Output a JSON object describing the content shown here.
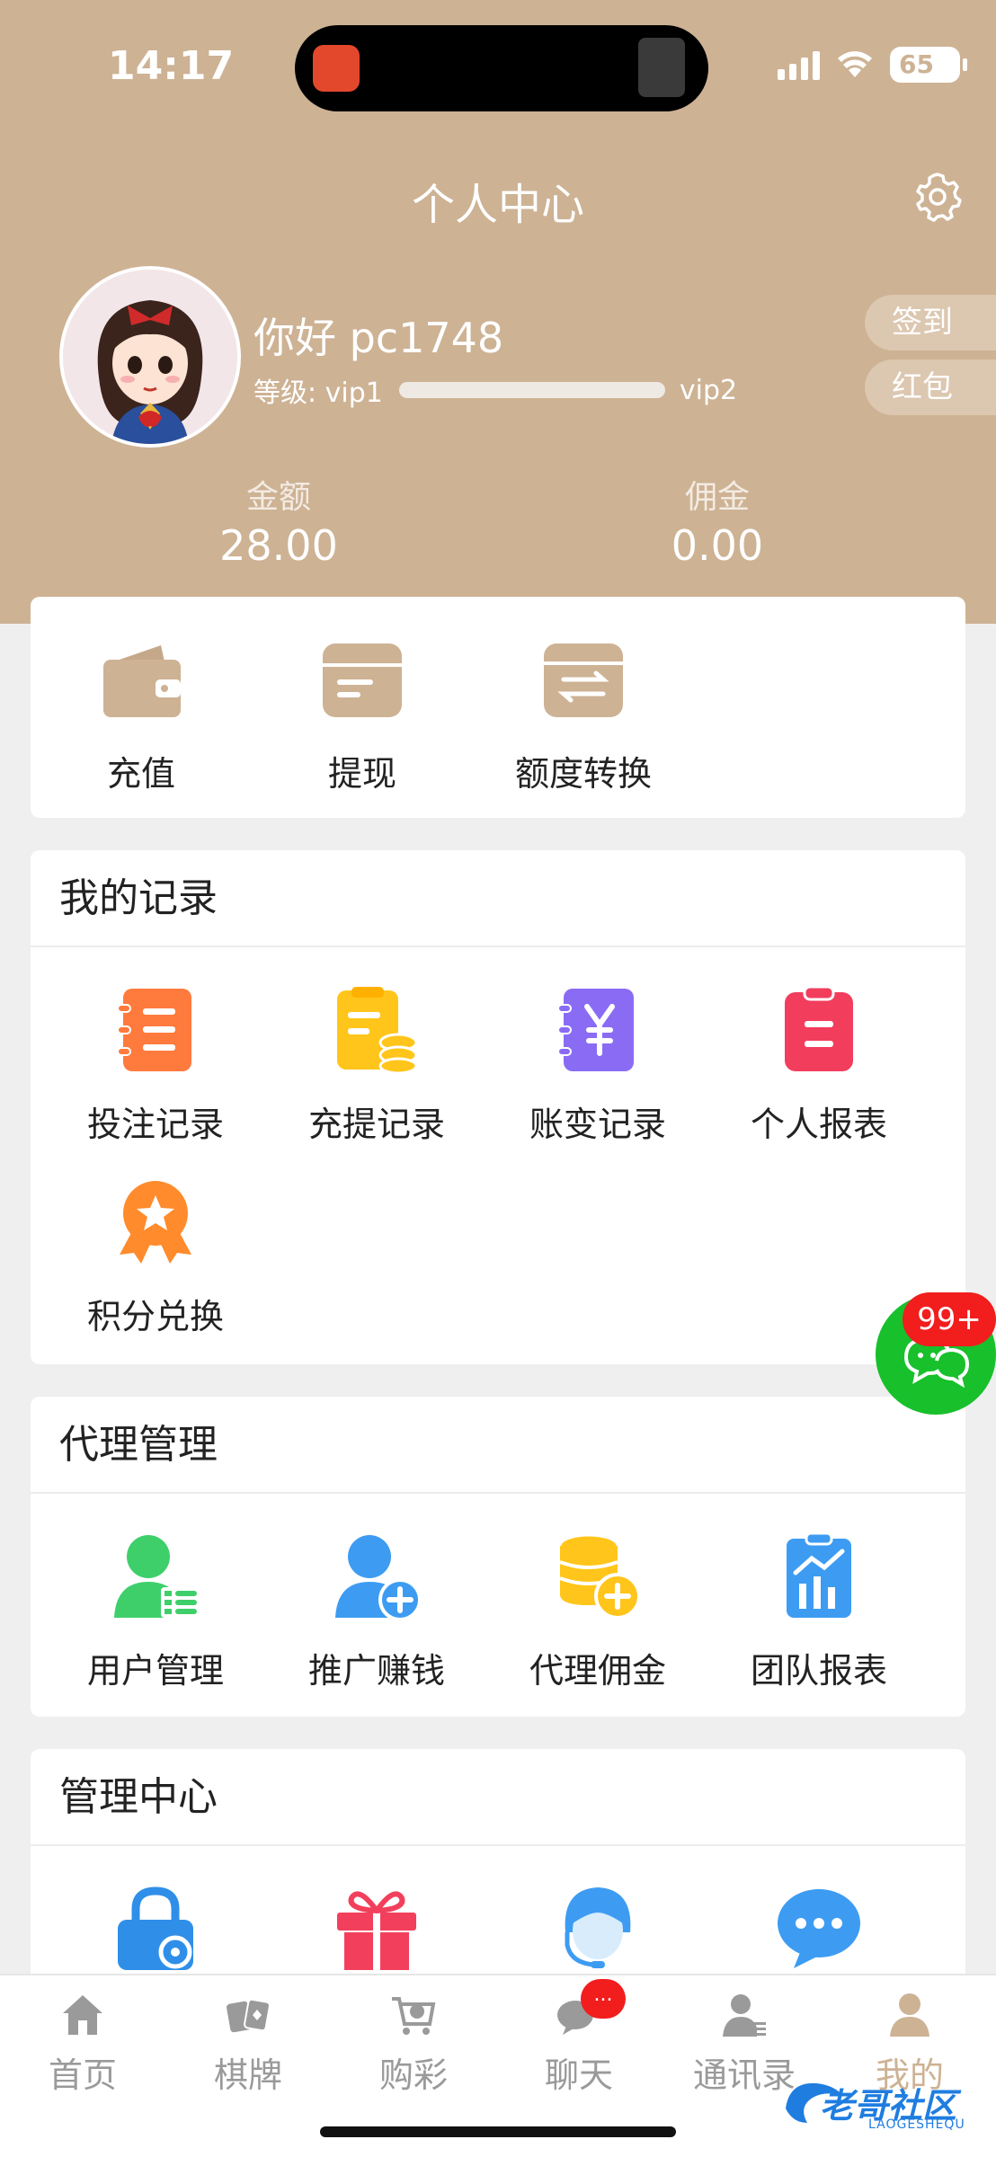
{
  "status": {
    "time": "14:17",
    "battery": "65"
  },
  "header": {
    "title": "个人中心"
  },
  "profile": {
    "greeting": "你好 pc1748",
    "level_label": "等级: vip1",
    "level_next": "vip2",
    "level_progress": 0.0,
    "sign_in": "签到",
    "red_packet": "红包",
    "balance_label": "金额",
    "balance_value": "28.00",
    "commission_label": "佣金",
    "commission_value": "0.00"
  },
  "wallet": {
    "items": [
      {
        "label": "充值",
        "icon": "wallet-icon"
      },
      {
        "label": "提现",
        "icon": "card-icon"
      },
      {
        "label": "额度转换",
        "icon": "transfer-icon"
      }
    ]
  },
  "records": {
    "title": "我的记录",
    "items": [
      {
        "label": "投注记录",
        "icon": "bet-record-icon",
        "color": "#ff7a3d"
      },
      {
        "label": "充提记录",
        "icon": "deposit-record-icon",
        "color": "#ffc51a"
      },
      {
        "label": "账变记录",
        "icon": "yen-record-icon",
        "color": "#8a6cf4"
      },
      {
        "label": "个人报表",
        "icon": "report-icon",
        "color": "#f23d5c"
      },
      {
        "label": "积分兑换",
        "icon": "medal-icon",
        "color": "#ff8b2c"
      }
    ]
  },
  "agent": {
    "title": "代理管理",
    "items": [
      {
        "label": "用户管理",
        "icon": "user-manage-icon",
        "color": "#3ecf6a"
      },
      {
        "label": "推广赚钱",
        "icon": "add-user-icon",
        "color": "#3d9cf2"
      },
      {
        "label": "代理佣金",
        "icon": "coins-icon",
        "color": "#ffc51a"
      },
      {
        "label": "团队报表",
        "icon": "team-report-icon",
        "color": "#3d9cf2"
      }
    ]
  },
  "management": {
    "title": "管理中心",
    "items": [
      {
        "icon": "lock-settings-icon",
        "color": "#2f8fe8"
      },
      {
        "icon": "gift-icon",
        "color": "#f2405c"
      },
      {
        "icon": "customer-service-icon",
        "color": "#3d9cf2"
      },
      {
        "icon": "message-icon",
        "color": "#3d9cf2"
      }
    ]
  },
  "float_chat": {
    "badge": "99+",
    "icon": "chat-icon"
  },
  "tabs": [
    {
      "label": "首页",
      "icon": "home-icon"
    },
    {
      "label": "棋牌",
      "icon": "cards-icon"
    },
    {
      "label": "购彩",
      "icon": "cart-icon"
    },
    {
      "label": "聊天",
      "icon": "chat-bubble-icon",
      "badge": "..."
    },
    {
      "label": "通讯录",
      "icon": "contacts-icon"
    },
    {
      "label": "我的",
      "icon": "profile-icon",
      "active": true
    }
  ],
  "watermark": {
    "text": "老哥社区",
    "sub": "LAOGESHEQU"
  },
  "colors": {
    "brand": "#cdb294",
    "badge": "#f21d1d",
    "chat_green": "#18c02c"
  }
}
